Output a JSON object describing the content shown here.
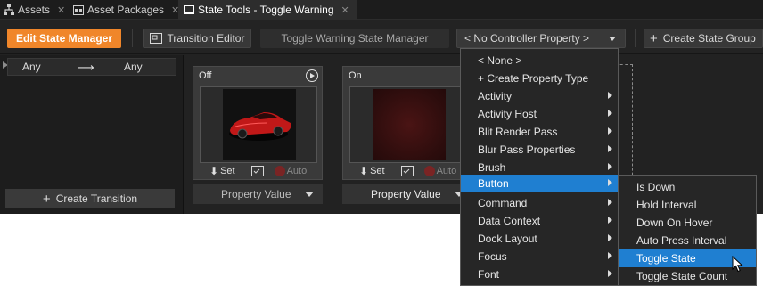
{
  "tabs": [
    {
      "label": "Assets",
      "icon": "sitemap-icon"
    },
    {
      "label": "Asset Packages",
      "icon": "package-icon"
    },
    {
      "label": "State Tools - Toggle Warning",
      "icon": "window-icon"
    }
  ],
  "toolbar": {
    "edit_state_manager": "Edit State Manager",
    "transition_editor": "Transition Editor",
    "state_manager_name": "Toggle Warning State Manager",
    "controller_property": "< No Controller Property >",
    "create_state_group": "Create State Group"
  },
  "left_panel": {
    "from": "Any",
    "to": "Any",
    "create_transition": "Create Transition"
  },
  "states": [
    {
      "name": "Off",
      "set_label": "Set",
      "auto_label": "Auto",
      "property_value": "Property Value"
    },
    {
      "name": "On",
      "set_label": "Set",
      "auto_label": "Auto",
      "property_value": "Property Value"
    }
  ],
  "menu": {
    "items": [
      {
        "label": "< None >",
        "submenu": false
      },
      {
        "label": "+ Create Property Type",
        "submenu": false
      },
      {
        "label": "Activity",
        "submenu": true
      },
      {
        "label": "Activity Host",
        "submenu": true
      },
      {
        "label": "Blit Render Pass",
        "submenu": true
      },
      {
        "label": "Blur Pass Properties",
        "submenu": true
      },
      {
        "label": "Brush",
        "submenu": true
      },
      {
        "label": "Button",
        "submenu": true,
        "selected": true
      },
      {
        "label": "Command",
        "submenu": true
      },
      {
        "label": "Data Context",
        "submenu": true
      },
      {
        "label": "Dock Layout",
        "submenu": true
      },
      {
        "label": "Focus",
        "submenu": true
      },
      {
        "label": "Font",
        "submenu": true
      }
    ],
    "submenu": [
      {
        "label": "Is Down"
      },
      {
        "label": "Hold Interval"
      },
      {
        "label": "Down On Hover"
      },
      {
        "label": "Auto Press Interval"
      },
      {
        "label": "Toggle State",
        "selected": true
      },
      {
        "label": "Toggle State Count"
      }
    ]
  },
  "colors": {
    "accent_orange": "#f0862a",
    "selection_blue": "#1f7fd1"
  }
}
